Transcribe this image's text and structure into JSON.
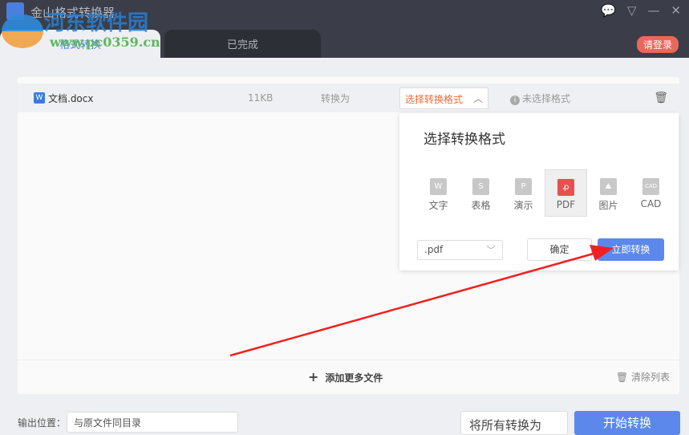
{
  "app": {
    "title": "金山格式转换器",
    "login": "请登录"
  },
  "tabs": [
    {
      "label": "格式转换"
    },
    {
      "label": "已完成"
    }
  ],
  "watermark": {
    "name": "河东软件园",
    "url": "www.pc0359.cn"
  },
  "file": {
    "icon": "W",
    "name": "文档.docx",
    "size": "11KB",
    "convert_to": "转换为",
    "format_select": "选择转换格式",
    "status": "未选择格式"
  },
  "popup": {
    "title": "选择转换格式",
    "formats": [
      {
        "icon": "W",
        "label": "文字"
      },
      {
        "icon": "S",
        "label": "表格"
      },
      {
        "icon": "P",
        "label": "演示"
      },
      {
        "icon": "ꝓ",
        "label": "PDF"
      },
      {
        "icon": "⛰",
        "label": "图片"
      },
      {
        "icon": "CAD",
        "label": "CAD"
      }
    ],
    "selected": "PDF",
    "ext": ".pdf",
    "ok": "确定",
    "convert_now": "立即转换"
  },
  "list": {
    "add_more": "添加更多文件",
    "clear": "清除列表"
  },
  "footer": {
    "output_label": "输出位置：",
    "output_value": "与原文件同目录",
    "convert_all": "将所有转换为",
    "start": "开始转换"
  }
}
